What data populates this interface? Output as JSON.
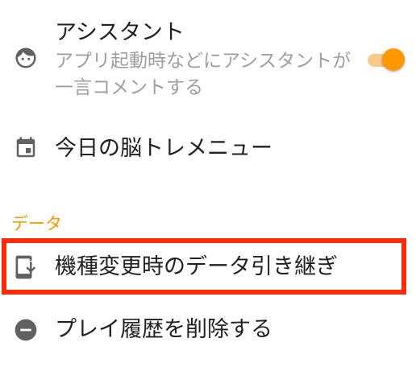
{
  "settings": {
    "assistant": {
      "title": "アシスタント",
      "summary": "アプリ起動時などにアシスタントが一言コメントする",
      "icon": "face-icon",
      "enabled": true
    },
    "today_menu": {
      "title": "今日の脳トレメニュー",
      "icon": "calendar-icon"
    },
    "data_section": {
      "header": "データ",
      "migration": {
        "title": "機種変更時のデータ引き継ぎ",
        "icon": "phone-download-icon"
      },
      "delete_history": {
        "title": "プレイ履歴を削除する",
        "icon": "remove-circle-icon"
      }
    }
  },
  "colors": {
    "accent": "#ff9800",
    "accent_track": "#f9c98a",
    "highlight": "#ff2a0a",
    "icon": "#616161",
    "secondary_text": "#9e9e9e"
  }
}
